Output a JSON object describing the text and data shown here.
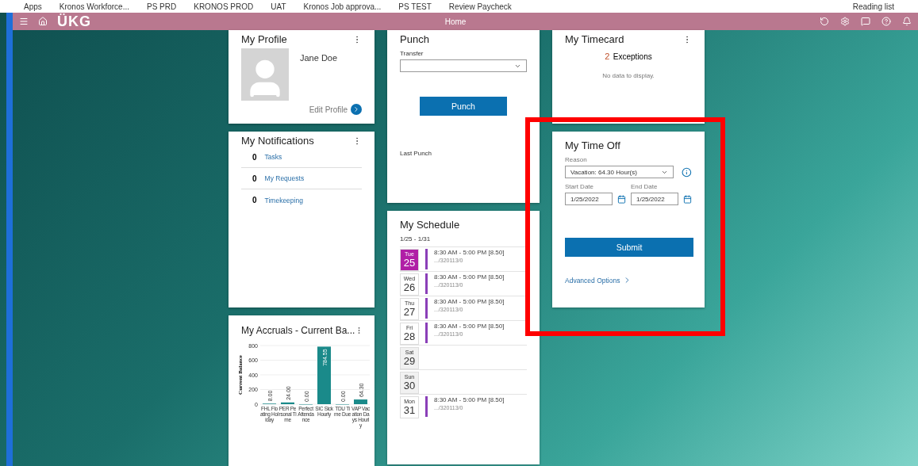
{
  "bookmarks": [
    "Apps",
    "Kronos Workforce...",
    "PS PRD",
    "KRONOS PROD",
    "UAT",
    "Kronos Job approva...",
    "PS TEST",
    "Review Paycheck"
  ],
  "reading_list": "Reading list",
  "header": {
    "logo": "ÜKG",
    "title": "Home"
  },
  "profile": {
    "title": "My Profile",
    "name": "Jane Doe",
    "link": "Edit Profile"
  },
  "notifications": {
    "title": "My Notifications",
    "items": [
      {
        "count": "0",
        "label": "Tasks"
      },
      {
        "count": "0",
        "label": "My Requests"
      },
      {
        "count": "0",
        "label": "Timekeeping"
      }
    ]
  },
  "accruals": {
    "title": "My Accruals - Current Ba...",
    "chart_data": {
      "type": "bar",
      "ylabel": "Current Balance",
      "categories": [
        "FHL Floating Holiday",
        "PER Personal Time",
        "Perfect Attendance",
        "SIC Sick Hourly",
        "TDU Time Due",
        "VAP Vacation Days Hourly"
      ],
      "series": [
        {
          "color": "#1a8a8a",
          "values": [
            8,
            24,
            0,
            785,
            0,
            64
          ]
        }
      ],
      "grid": true,
      "value_labels": [
        "8.00",
        "24.00",
        "0.00",
        "784.55",
        "0.00",
        "64.30"
      ],
      "ylim": [
        0,
        800
      ],
      "yticks": [
        0,
        200,
        400,
        600,
        800
      ]
    }
  },
  "punch": {
    "title": "Punch",
    "transfer_label": "Transfer",
    "button": "Punch",
    "last_punch": "Last Punch"
  },
  "schedule": {
    "title": "My Schedule",
    "range": "1/25 - 1/31",
    "days": [
      {
        "dow": "Tue",
        "day": "25",
        "selected": true,
        "shift": "8:30 AM - 5:00 PM [8.50]",
        "detail": ".../320113/0"
      },
      {
        "dow": "Wed",
        "day": "26",
        "selected": false,
        "shift": "8:30 AM - 5:00 PM [8.50]",
        "detail": ".../320113/0"
      },
      {
        "dow": "Thu",
        "day": "27",
        "selected": false,
        "shift": "8:30 AM - 5:00 PM [8.50]",
        "detail": ".../320113/0"
      },
      {
        "dow": "Fri",
        "day": "28",
        "selected": false,
        "shift": "8:30 AM - 5:00 PM [8.50]",
        "detail": ".../320113/0"
      },
      {
        "dow": "Sat",
        "day": "29",
        "selected": false
      },
      {
        "dow": "Sun",
        "day": "30",
        "selected": false
      },
      {
        "dow": "Mon",
        "day": "31",
        "selected": false,
        "shift": "8:30 AM - 5:00 PM [8.50]",
        "detail": ".../320113/0"
      }
    ]
  },
  "timecard": {
    "title": "My Timecard",
    "exceptions_count": "2",
    "exceptions_label": "Exceptions",
    "empty": "No data to display."
  },
  "time_off": {
    "title": "My Time Off",
    "reason_label": "Reason",
    "reason": "Vacation: 64.30 Hour(s)",
    "start_label": "Start Date",
    "start": "1/25/2022",
    "end_label": "End Date",
    "end": "1/25/2022",
    "submit": "Submit",
    "advanced": "Advanced Options"
  }
}
